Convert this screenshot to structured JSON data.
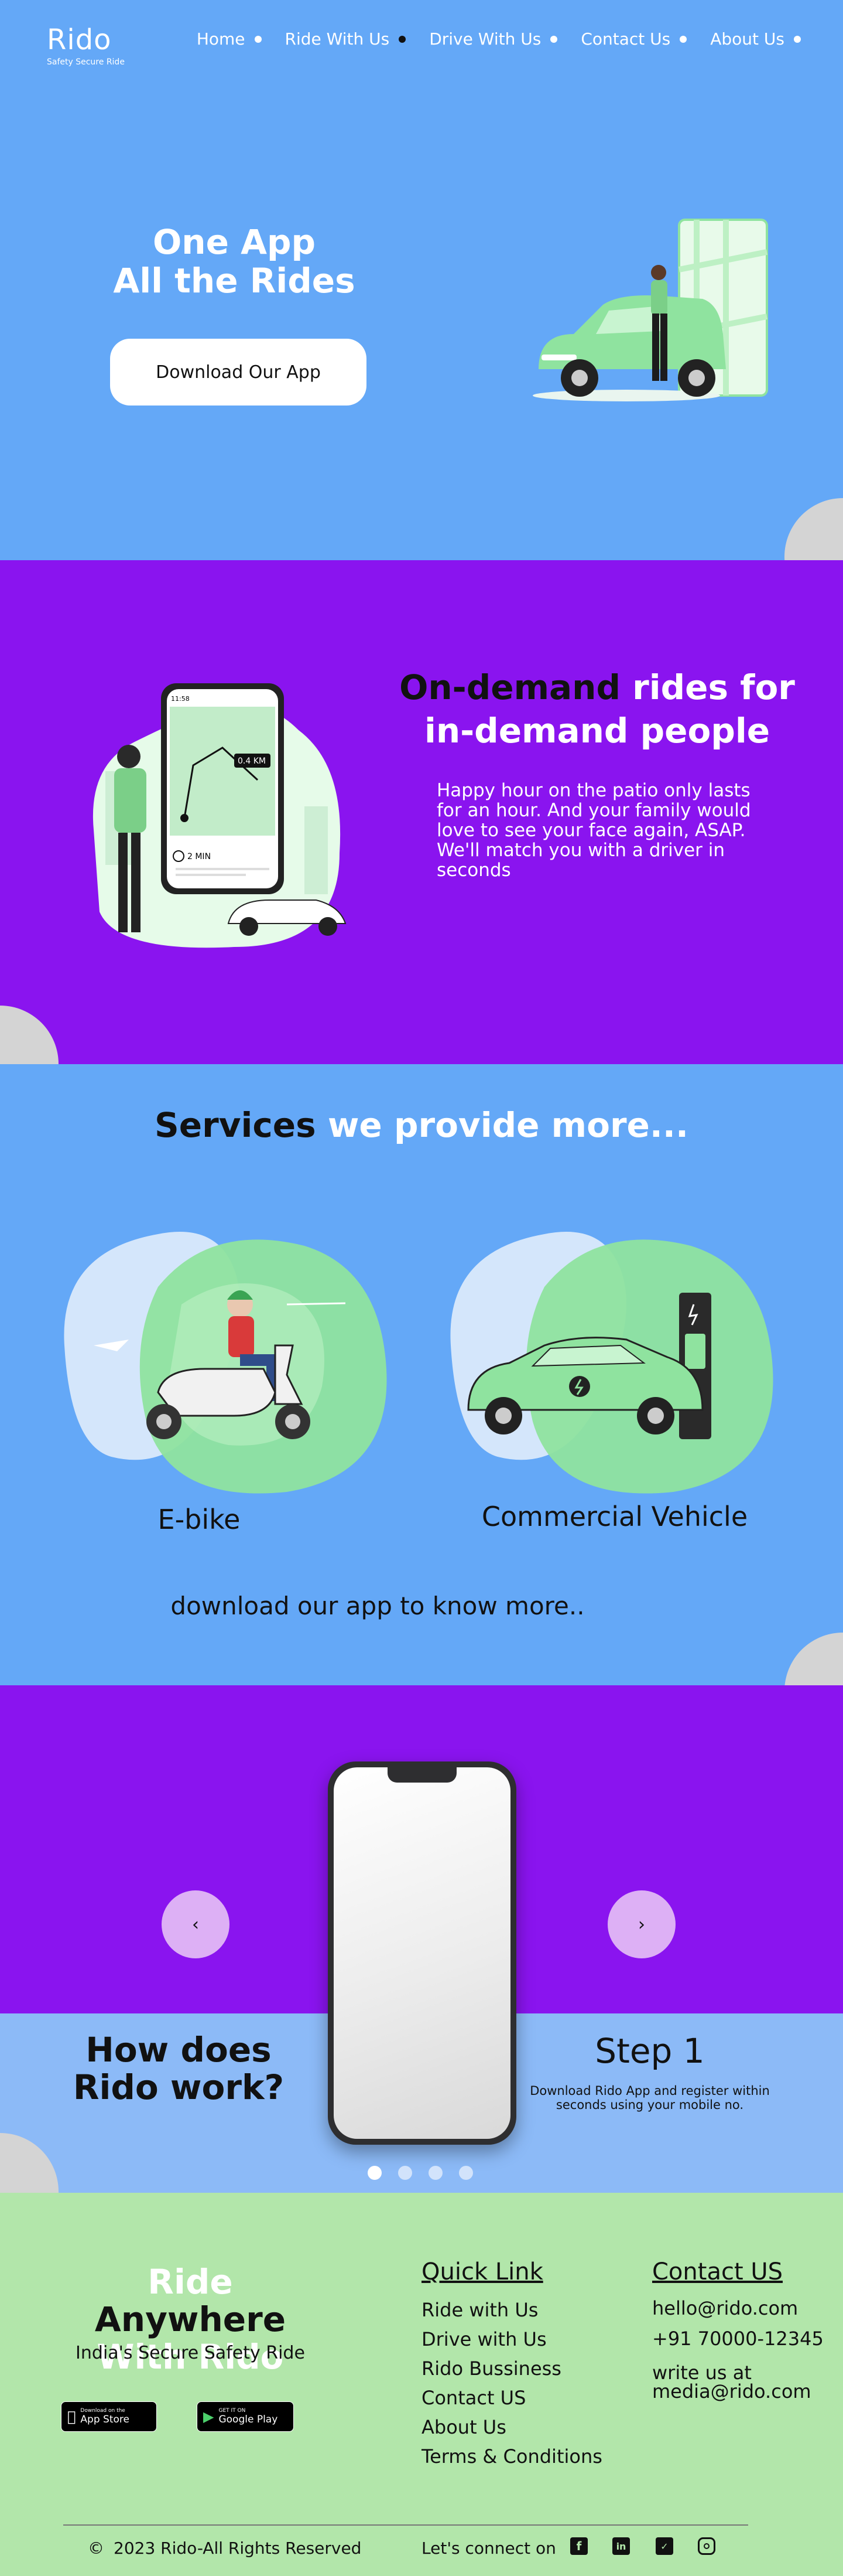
{
  "brand": {
    "name": "Rido",
    "tagline": "Safety Secure Ride"
  },
  "nav": {
    "items": [
      {
        "label": "Home",
        "active": false
      },
      {
        "label": "Ride With Us",
        "active": true
      },
      {
        "label": "Drive With Us",
        "active": false
      },
      {
        "label": "Contact Us",
        "active": false
      },
      {
        "label": "About Us",
        "active": false
      }
    ]
  },
  "hero": {
    "title_line1": "One App",
    "title_line2": "All the Rides",
    "cta_label": "Download Our App"
  },
  "ondemand": {
    "title_dark": "On-demand",
    "title_light1": " rides for",
    "title_light2": "in-demand people",
    "text": "Happy hour on the patio only lasts for an hour. And your family would love to see your face again, ASAP. We'll match you with a driver in seconds",
    "map_distance": "0.4 KM",
    "eta": "2 MIN",
    "phone_time": "11:58"
  },
  "services": {
    "title_dark": "Services",
    "title_light": " we provide more...",
    "items": [
      {
        "label": "E-bike",
        "icon": "scooter-illustration"
      },
      {
        "label": "Commercial Vehicle",
        "icon": "ev-car-illustration"
      }
    ],
    "download_text": "download our app to know more.."
  },
  "how": {
    "title_line1": "How does",
    "title_line2": "Rido work?",
    "step_title": "Step 1",
    "step_desc": "Download Rido App and register within seconds using your mobile no.",
    "prev_label": "‹",
    "next_label": "›",
    "dots": 4,
    "active_dot": 0
  },
  "footer": {
    "title_light1": "Ride",
    "title_dark1": " Anywhere",
    "title_light2": "With Rido",
    "tagline": "India's Secure Safety Ride",
    "appstore": {
      "small": "Download on the",
      "big": "App Store"
    },
    "googleplay": {
      "small": "GET IT ON",
      "big": "Google Play"
    },
    "quick_links_head": "Quick Link",
    "quick_links": [
      "Ride with Us",
      "Drive with Us",
      "Rido Bussiness",
      "Contact US",
      "About Us",
      "Terms & Conditions"
    ],
    "contact_head": "Contact US",
    "email": "hello@rido.com",
    "phone": "+91 70000-12345",
    "media_line1": "write us at",
    "media_line2": "media@rido.com",
    "copyright": "2023 Rido-All Rights Reserved",
    "connect": "Let's connect on",
    "socials": [
      "facebook-icon",
      "linkedin-icon",
      "twitter-icon",
      "instagram-icon"
    ]
  },
  "colors": {
    "blue": "#64a8f7",
    "purple": "#8a14ef",
    "light_blue": "#8cbaf7",
    "green": "#b2e6aa",
    "accent_green": "#8fe39f"
  }
}
